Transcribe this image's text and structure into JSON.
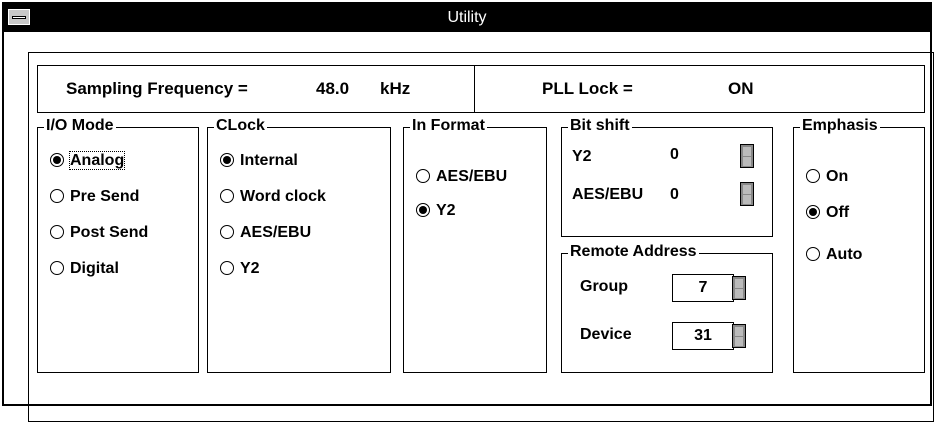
{
  "window": {
    "title": "Utility"
  },
  "status": {
    "sampling_label": "Sampling Frequency =",
    "sampling_value": "48.0",
    "sampling_unit": "kHz",
    "pll_label": "PLL Lock =",
    "pll_value": "ON"
  },
  "io_mode": {
    "title": "I/O Mode",
    "options": [
      "Analog",
      "Pre Send",
      "Post Send",
      "Digital"
    ],
    "selected": "Analog"
  },
  "clock": {
    "title": "CLock",
    "options": [
      "Internal",
      "Word clock",
      "AES/EBU",
      "Y2"
    ],
    "selected": "Internal"
  },
  "in_format": {
    "title": "In Format",
    "options": [
      "AES/EBU",
      "Y2"
    ],
    "selected": "Y2"
  },
  "bit_shift": {
    "title": "Bit shift",
    "rows": [
      {
        "label": "Y2",
        "value": "0"
      },
      {
        "label": "AES/EBU",
        "value": "0"
      }
    ]
  },
  "remote_address": {
    "title": "Remote Address",
    "group_label": "Group",
    "group_value": "7",
    "device_label": "Device",
    "device_value": "31"
  },
  "emphasis": {
    "title": "Emphasis",
    "options": [
      "On",
      "Off",
      "Auto"
    ],
    "selected": "Off"
  }
}
